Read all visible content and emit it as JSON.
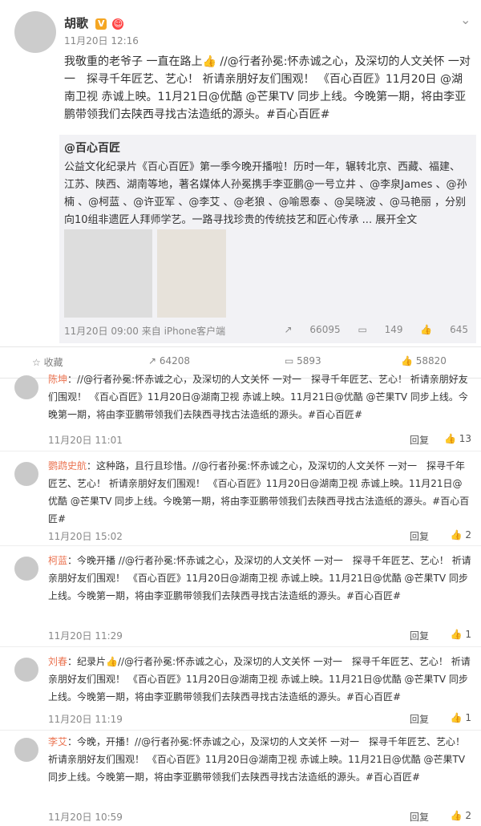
{
  "post": {
    "author": "胡歌",
    "time": "11月20日 12:16",
    "text": "我敬重的老爷子 一直在路上👍 //@行者孙冕:怀赤诚之心，及深切的人文关怀 一对一　探寻千年匠艺、艺心！ 祈请亲朋好友们围观！ 《百心百匠》11月20日 @湖南卫视 赤诚上映。11月21日@优酷 @芒果TV 同步上线。今晚第一期，将由李亚鹏带领我们去陕西寻找古法造纸的源头。#百心百匠#",
    "repost": {
      "author": "@百心百匠",
      "text": "公益文化纪录片《百心百匠》第一季今晚开播啦！历时一年，辗转北京、西藏、福建、江苏、陕西、湖南等地，著名媒体人孙冕携手李亚鹏@一号立井 、@李泉James 、@孙楠 、@柯蓝 、@许亚军 、@李艾 、@老狼 、@喻恩泰 、@吴晓波 、@马艳丽 ，分别向10组非遗匠人拜师学艺。一路寻找珍贵的传统技艺和匠心传承 ... 展开全文",
      "time": "11月20日 09:00 来自 iPhone客户端",
      "reposts": "66095",
      "comments": "149",
      "likes": "645"
    },
    "actions": {
      "collect": "收藏",
      "repost": "64208",
      "comment": "5893",
      "like": "58820"
    }
  },
  "comments": [
    {
      "name": "陈坤",
      "text": "：//@行者孙冕:怀赤诚之心，及深切的人文关怀 一对一　探寻千年匠艺、艺心！ 祈请亲朋好友们围观！ 《百心百匠》11月20日@湖南卫视 赤诚上映。11月21日@优酷 @芒果TV 同步上线。今晚第一期，将由李亚鹏带领我们去陕西寻找古法造纸的源头。#百心百匠#",
      "time": "11月20日 11:01",
      "reply": "回复",
      "likes": "13"
    },
    {
      "name": "鹦鹉史航",
      "text": "：这种路，且行且珍惜。//@行者孙冕:怀赤诚之心，及深切的人文关怀 一对一　探寻千年匠艺、艺心！ 祈请亲朋好友们围观！ 《百心百匠》11月20日@湖南卫视 赤诚上映。11月21日@优酷 @芒果TV 同步上线。今晚第一期，将由李亚鹏带领我们去陕西寻找古法造纸的源头。#百心百匠#",
      "time": "11月20日 15:02",
      "reply": "回复",
      "likes": "2"
    },
    {
      "name": "柯蓝",
      "text": "：今晚开播 //@行者孙冕:怀赤诚之心，及深切的人文关怀 一对一　探寻千年匠艺、艺心！ 祈请亲朋好友们围观！ 《百心百匠》11月20日@湖南卫视 赤诚上映。11月21日@优酷 @芒果TV 同步上线。今晚第一期，将由李亚鹏带领我们去陕西寻找古法造纸的源头。#百心百匠#",
      "time": "11月20日 11:29",
      "reply": "回复",
      "likes": "1"
    },
    {
      "name": "刘春",
      "text": "：纪录片👍//@行者孙冕:怀赤诚之心，及深切的人文关怀 一对一　探寻千年匠艺、艺心！ 祈请亲朋好友们围观！ 《百心百匠》11月20日@湖南卫视 赤诚上映。11月21日@优酷 @芒果TV 同步上线。今晚第一期，将由李亚鹏带领我们去陕西寻找古法造纸的源头。#百心百匠#",
      "time": "11月20日 11:19",
      "reply": "回复",
      "likes": "1"
    },
    {
      "name": "李艾",
      "text": "：今晚，开播！//@行者孙冕:怀赤诚之心，及深切的人文关怀 一对一　探寻千年匠艺、艺心！ 祈请亲朋好友们围观！ 《百心百匠》11月20日@湖南卫视 赤诚上映。11月21日@优酷 @芒果TV 同步上线。今晚第一期，将由李亚鹏带领我们去陕西寻找古法造纸的源头。#百心百匠#",
      "time": "11月20日 10:59",
      "reply": "回复",
      "likes": "2"
    }
  ]
}
